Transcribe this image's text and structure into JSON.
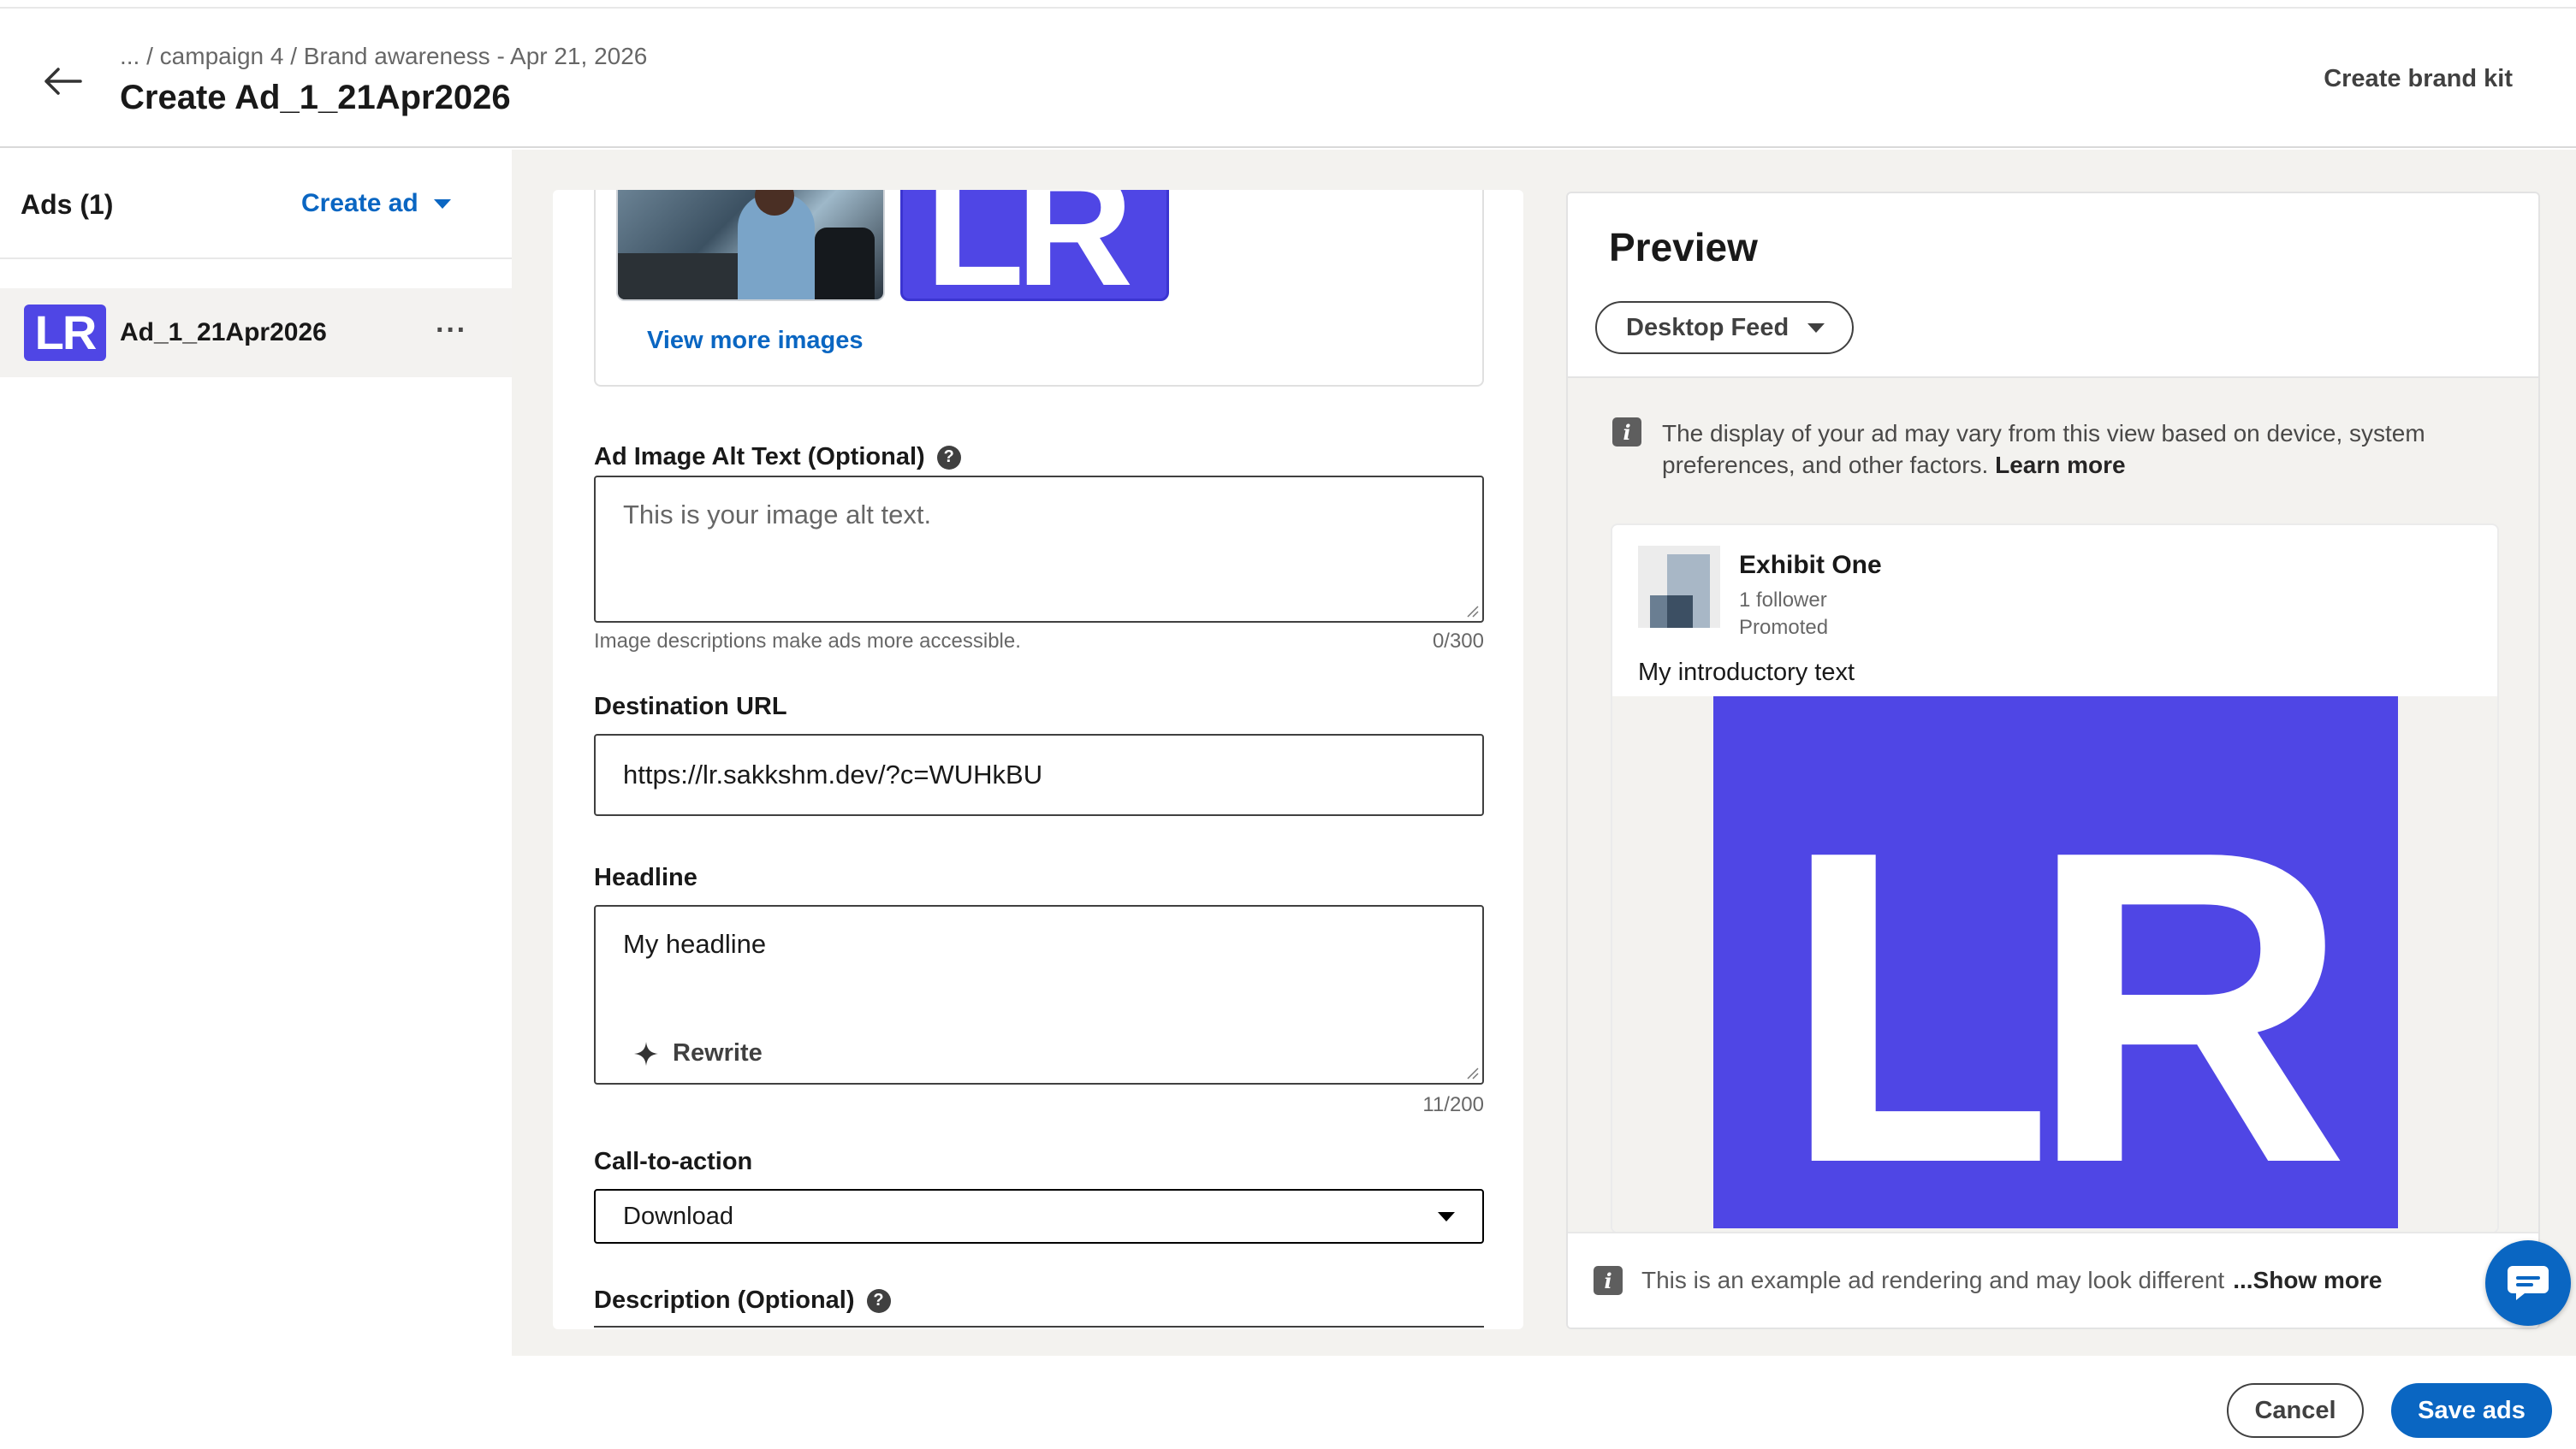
{
  "header": {
    "breadcrumb": "... / campaign 4 / Brand awareness - Apr 21, 2026",
    "title": "Create Ad_1_21Apr2026",
    "brand_kit_label": "Create brand kit"
  },
  "sidebar": {
    "ads_count_label": "Ads (1)",
    "create_ad_label": "Create ad",
    "items": [
      {
        "thumb_text": "LR",
        "name": "Ad_1_21Apr2026",
        "more_label": "···"
      }
    ]
  },
  "form": {
    "images": {
      "logo_text": "LR",
      "view_more_label": "View more images"
    },
    "alt_text": {
      "label": "Ad Image Alt Text (Optional)",
      "placeholder": "This is your image alt text.",
      "helper": "Image descriptions make ads more accessible.",
      "counter": "0/300"
    },
    "destination_url": {
      "label": "Destination URL",
      "value": "https://lr.sakkshm.dev/?c=WUHkBU"
    },
    "headline": {
      "label": "Headline",
      "value": "My headline",
      "rewrite_label": "Rewrite",
      "counter": "11/200"
    },
    "cta": {
      "label": "Call-to-action",
      "value": "Download"
    },
    "description": {
      "label": "Description (Optional)"
    }
  },
  "preview": {
    "title": "Preview",
    "feed_option": "Desktop Feed",
    "notice": "The display of your ad may vary from this view based on device, system preferences, and other factors.",
    "learn_more": "Learn more",
    "card": {
      "company": "Exhibit One",
      "followers": "1 follower",
      "promoted": "Promoted",
      "intro_text": "My introductory text",
      "image_text": "LR"
    },
    "footer_note": "This is an example ad rendering and may look different",
    "show_more": "...Show more"
  },
  "actions": {
    "cancel_label": "Cancel",
    "save_label": "Save ads"
  },
  "colors": {
    "accent": "#0a66c2",
    "logo_bg": "#4f46e5",
    "canvas_bg": "#f3f2ef"
  },
  "icons": [
    "back-arrow-icon",
    "caret-down-icon",
    "more-horizontal-icon",
    "help-icon",
    "sparkle-icon",
    "info-icon",
    "chat-icon",
    "resize-handle-icon"
  ]
}
